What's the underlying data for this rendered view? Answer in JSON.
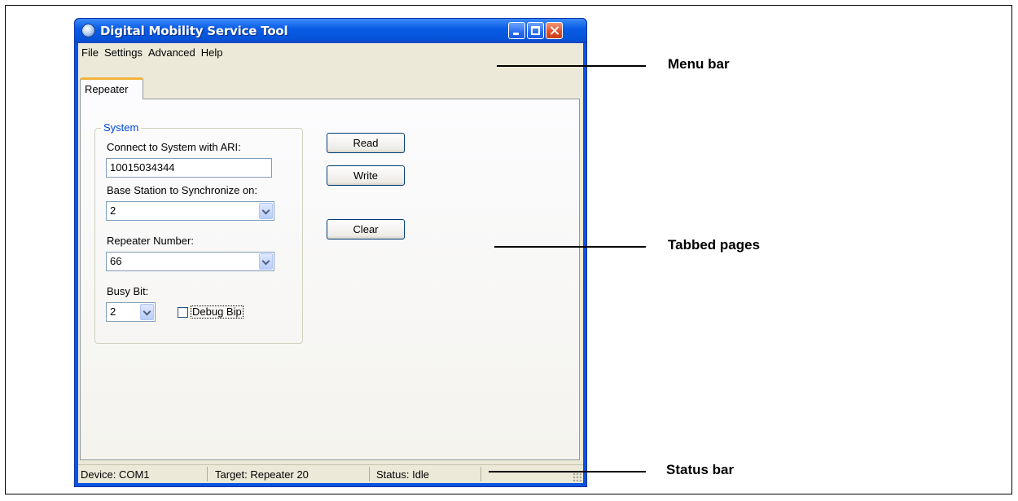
{
  "window": {
    "title": "Digital Mobility Service Tool",
    "title_bar_color": "#0a55e0"
  },
  "menu": {
    "items": [
      {
        "label": "File"
      },
      {
        "label": "Settings"
      },
      {
        "label": "Advanced"
      },
      {
        "label": "Help"
      }
    ]
  },
  "tabs": [
    {
      "label": "Repeater",
      "active": true
    }
  ],
  "system_group": {
    "title": "System",
    "ari_label": "Connect to System with ARI:",
    "ari_value": "10015034344",
    "base_station_label": "Base Station to Synchronize on:",
    "base_station_value": "2",
    "repeater_number_label": "Repeater Number:",
    "repeater_number_value": "66",
    "busy_bit_label": "Busy Bit:",
    "busy_bit_value": "2",
    "debug_bip_label": "Debug Bip",
    "debug_bip_checked": false
  },
  "buttons": {
    "read": "Read",
    "write": "Write",
    "clear": "Clear"
  },
  "status": {
    "device": "Device: COM1",
    "target": "Target: Repeater 20",
    "status": "Status: Idle"
  },
  "callouts": {
    "menu_bar": "Menu bar",
    "tabbed_pages": "Tabbed pages",
    "status_bar": "Status bar"
  }
}
